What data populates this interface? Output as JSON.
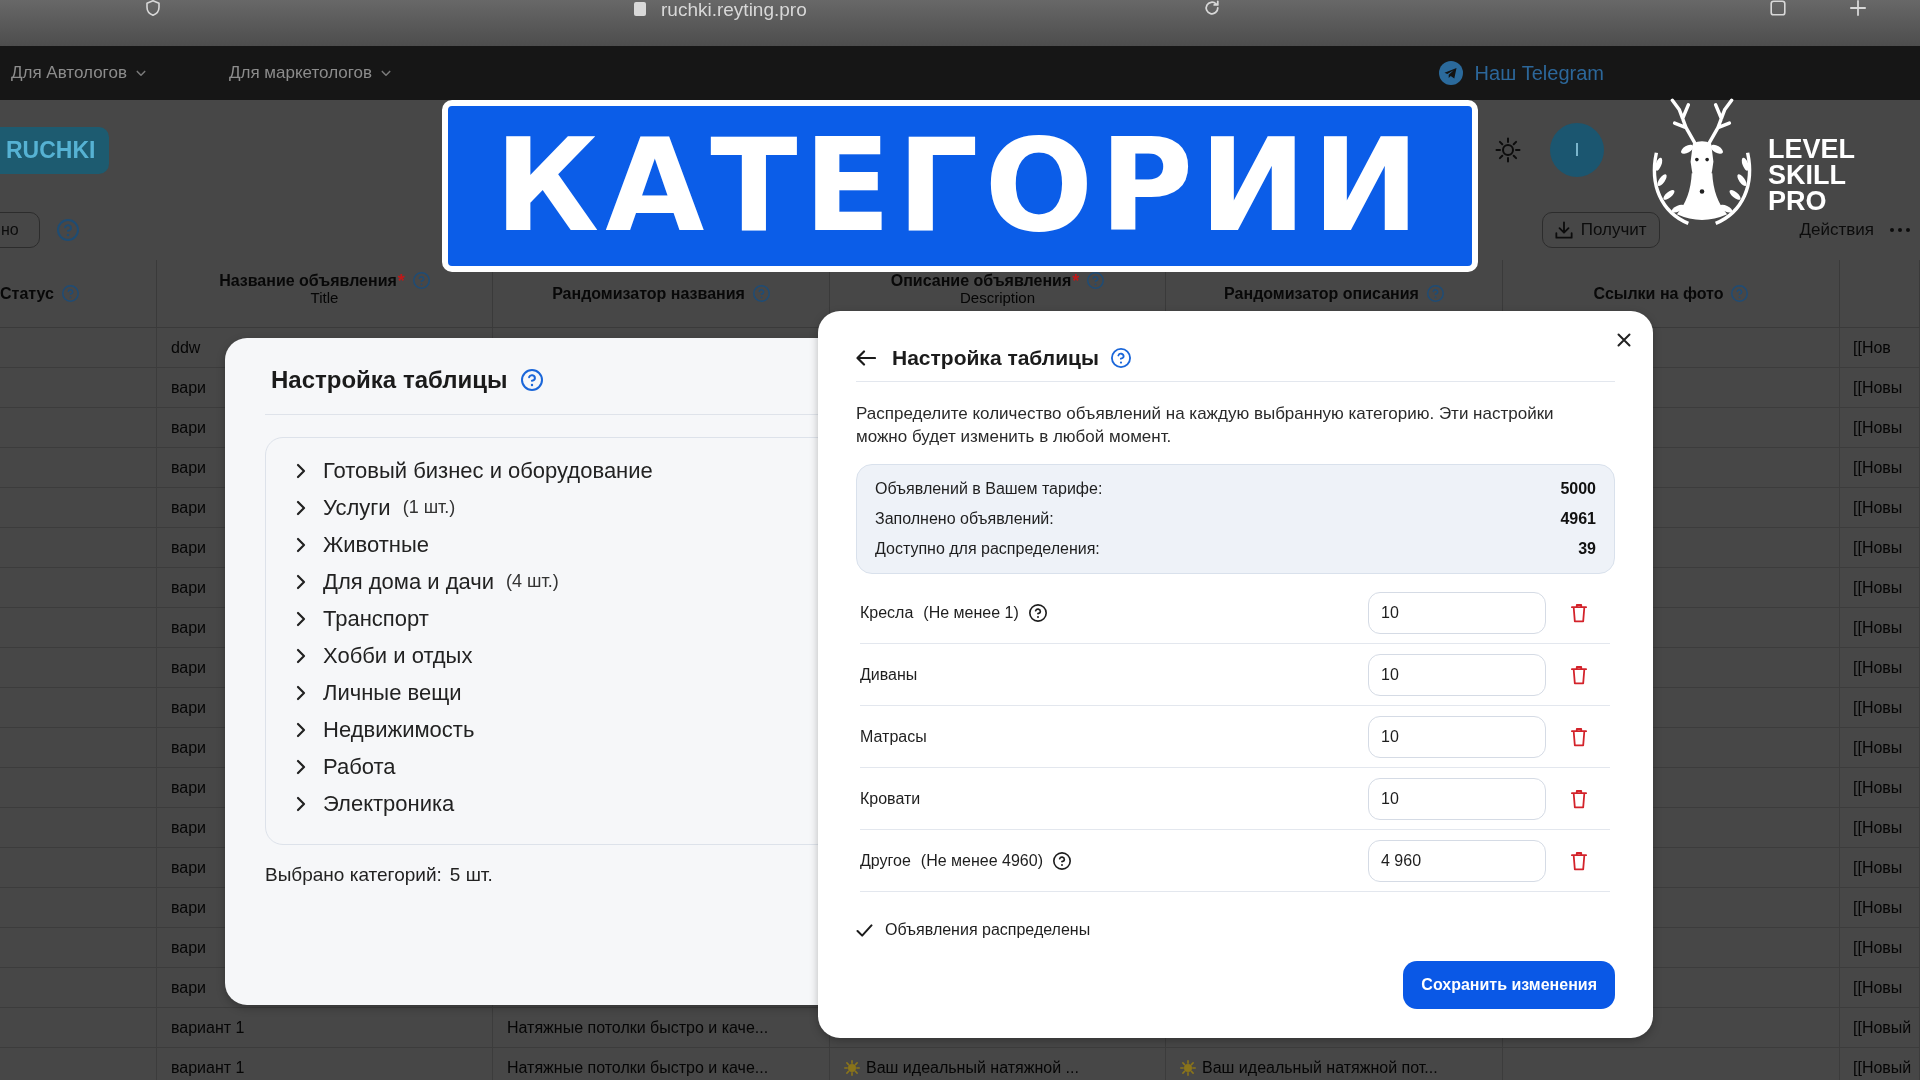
{
  "browser": {
    "url": "ruchki.reyting.pro"
  },
  "nav": {
    "items": [
      {
        "label": "Для Автологов"
      },
      {
        "label": "Для маркетологов"
      }
    ],
    "telegram": "Наш Telegram"
  },
  "header": {
    "logo": "RUCHKI",
    "avatar": "I"
  },
  "toolbar": {
    "filter_button": "но",
    "download_button": "Получит",
    "actions_button": "Действия"
  },
  "table": {
    "columns": [
      {
        "label": "Статус"
      },
      {
        "label": "Название объявления",
        "mark": "*",
        "sublabel": "Title"
      },
      {
        "label": "Рандомизатор названия"
      },
      {
        "label": "Описание объявления",
        "mark": "*",
        "sublabel": "Description"
      },
      {
        "label": "Рандомизатор описания"
      },
      {
        "label": "Ссылки на фото"
      }
    ],
    "rows": [
      {
        "title": "ddw",
        "column_7": "[[Нов"
      },
      {
        "title": "вари",
        "column_7": "[[Новы"
      },
      {
        "title": "вари",
        "column_7": "[[Новы"
      },
      {
        "title": "вари",
        "column_7": "[[Новы"
      },
      {
        "title": "вари",
        "column_7": "[[Новы"
      },
      {
        "title": "вари",
        "column_7": "[[Новы"
      },
      {
        "title": "вари",
        "column_7": "[[Новы"
      },
      {
        "title": "вари",
        "column_7": "[[Новы"
      },
      {
        "title": "вари",
        "column_7": "[[Новы"
      },
      {
        "title": "вари",
        "column_7": "[[Новы"
      },
      {
        "title": "вари",
        "column_7": "[[Новы"
      },
      {
        "title": "вари",
        "column_7": "[[Новы"
      },
      {
        "title": "вари",
        "column_7": "[[Новы"
      },
      {
        "title": "вари",
        "column_7": "[[Новы"
      },
      {
        "title": "вари",
        "column_7": "[[Новы"
      },
      {
        "title": "вари",
        "column_7": "[[Новы"
      },
      {
        "title": "вари",
        "column_7": "[[Новы"
      },
      {
        "title": "вариант 1",
        "title_randomizer": "Натяжные потолки быстро и каче...",
        "column_7": "[[Новый"
      },
      {
        "title": "вариант 1",
        "title_randomizer": "Натяжные потолки быстро и каче...",
        "description": "Ваш идеальный натяжной ...",
        "description_randomizer": "Ваш идеальный натяжной пот...",
        "column_7": "[[Новый"
      }
    ]
  },
  "banner": {
    "title": "КАТЕГОРИИ"
  },
  "brand": {
    "lines": [
      "LEVEL",
      "SKILL",
      "PRO"
    ]
  },
  "category_dialog": {
    "title": "Настройка таблицы",
    "categories": [
      {
        "label": "Готовый бизнес и оборудование",
        "expanded": false
      },
      {
        "label": "Услуги",
        "count": "(1 шт.)",
        "expanded": false
      },
      {
        "label": "Животные",
        "expanded": false
      },
      {
        "label": "Для дома и дачи",
        "count": "(4 шт.)",
        "expanded": false
      },
      {
        "label": "Транспорт",
        "expanded": false
      },
      {
        "label": "Хобби и отдых",
        "expanded": false
      },
      {
        "label": "Личные вещи",
        "expanded": false
      },
      {
        "label": "Недвижимость",
        "expanded": false
      },
      {
        "label": "Работа",
        "expanded": false
      },
      {
        "label": "Электроника",
        "expanded": false
      }
    ],
    "summary_label": "Выбрано категорий:",
    "summary_value": "5 шт."
  },
  "distribution_dialog": {
    "title": "Настройка таблицы",
    "description": "Распределите количество объявлений на каждую выбранную категорию. Эти настройки можно будет изменить в любой момент.",
    "stats": [
      {
        "label": "Объявлений в Вашем тарифе:",
        "value": "5000"
      },
      {
        "label": "Заполнено объявлений:",
        "value": "4961"
      },
      {
        "label": "Доступно для распределения:",
        "value": "39"
      }
    ],
    "allocations": [
      {
        "name": "Кресла",
        "hint": "(Не менее 1)",
        "value": "10"
      },
      {
        "name": "Диваны",
        "value": "10"
      },
      {
        "name": "Матрасы",
        "value": "10"
      },
      {
        "name": "Кровати",
        "value": "10"
      },
      {
        "name": "Другое",
        "hint": "(Не менее 4960)",
        "value": "4 960"
      }
    ],
    "status": {
      "text": "Объявления распределены",
      "done": true
    },
    "save_button": "Сохранить изменения"
  }
}
